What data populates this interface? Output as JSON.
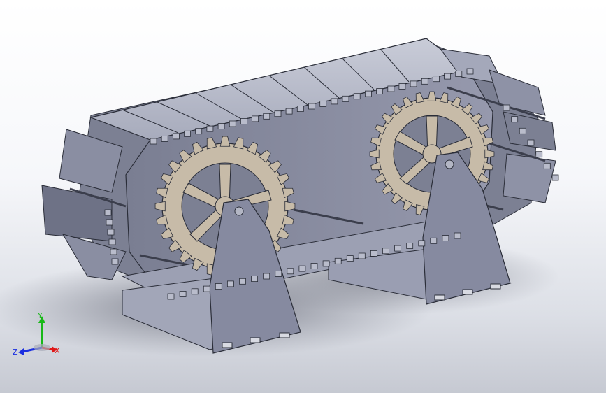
{
  "viewport": {
    "background_top": "#ffffff",
    "background_bottom": "#c6c9d2",
    "model_color": "#8e92a6",
    "model_edge_color": "#2a2d38",
    "gear_color": "#c7bba8",
    "shadow_color": "#6f7280"
  },
  "model": {
    "parts": [
      "track-belt",
      "drive-sprocket-front",
      "drive-sprocket-rear",
      "support-stand-front",
      "support-stand-rear",
      "base-tray",
      "axle-rods"
    ],
    "gear_teeth": 28,
    "gear_spokes": 5
  },
  "triad": {
    "x_label": "X",
    "y_label": "Y",
    "z_label": "Z",
    "x_color": "#e01818",
    "y_color": "#18b818",
    "z_color": "#1a2ee0"
  }
}
